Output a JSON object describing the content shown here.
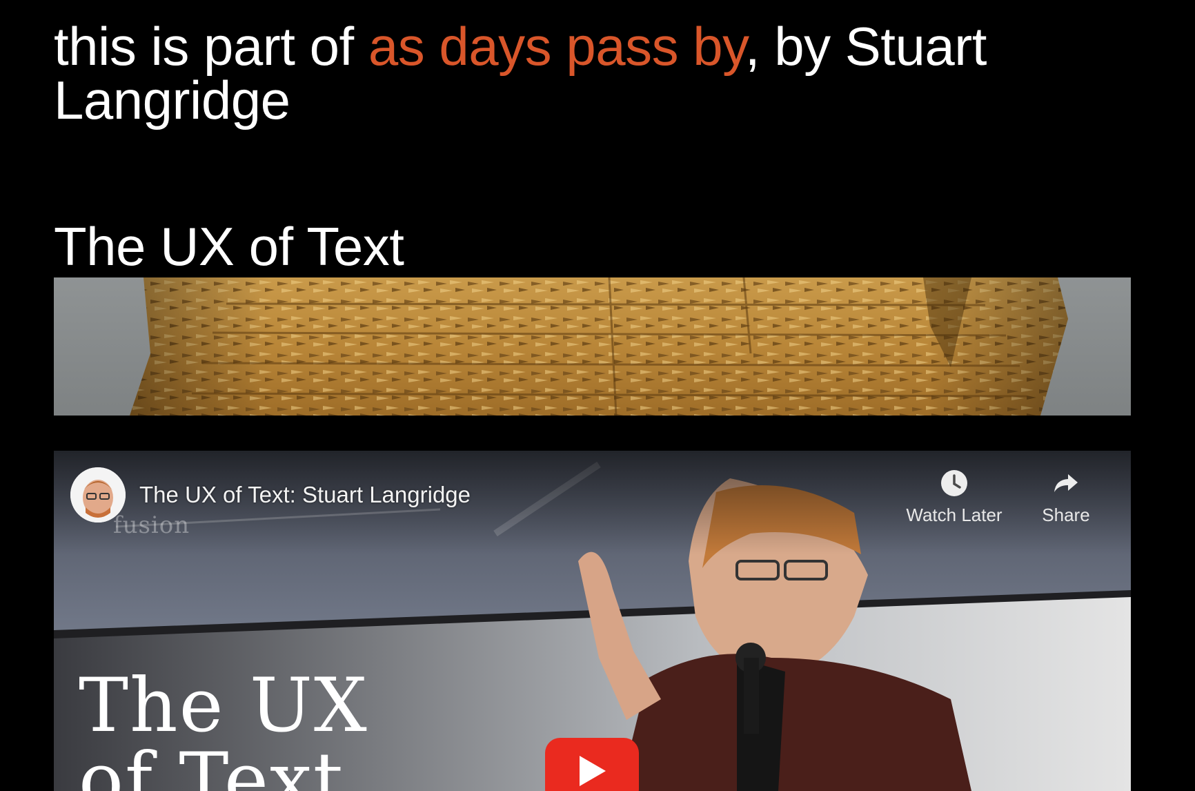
{
  "header": {
    "prefix": "this is part of ",
    "series_link": "as days pass by",
    "suffix": ", by Stuart Langridge"
  },
  "post": {
    "title": "The UX of Text"
  },
  "video": {
    "title": "The UX of Text: Stuart Langridge",
    "watermark": "fusion",
    "watch_later_label": "Watch Later",
    "share_label": "Share",
    "thumbnail_text_line1": "The UX",
    "thumbnail_text_line2": "of Text",
    "play_icon": "play-icon"
  },
  "colors": {
    "background": "#000000",
    "accent": "#d9562a",
    "play_red": "#ea2a1f"
  }
}
